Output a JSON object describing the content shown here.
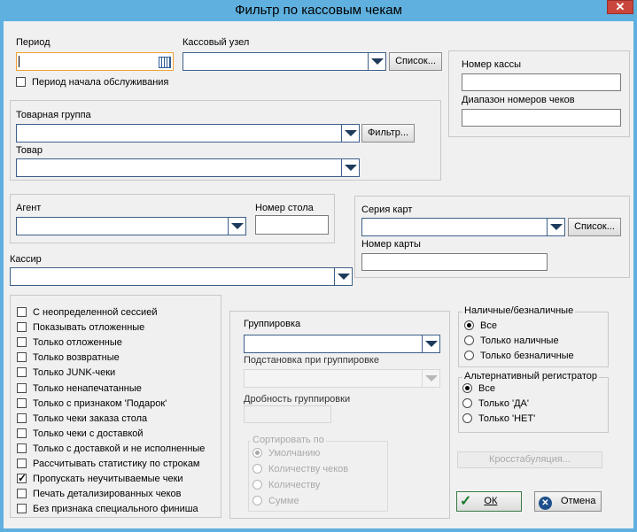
{
  "window": {
    "title": "Фильтр по кассовым чекам",
    "close_glyph": "✕"
  },
  "period": {
    "label": "Период",
    "value": "",
    "service_start_label": "Период начала обслуживания"
  },
  "cash_node": {
    "label": "Кассовый узел",
    "value": "",
    "list_button": "Список..."
  },
  "cash_desk": {
    "number_label": "Номер кассы",
    "number_value": "",
    "check_range_label": "Диапазон номеров чеков",
    "check_range_value": ""
  },
  "product": {
    "group_label": "Товарная группа",
    "group_value": "",
    "filter_button": "Фильтр...",
    "item_label": "Товар",
    "item_value": ""
  },
  "agent": {
    "label": "Агент",
    "value": "",
    "table_label": "Номер стола",
    "table_value": ""
  },
  "cards": {
    "series_label": "Серия карт",
    "series_value": "",
    "list_button": "Список...",
    "number_label": "Номер карты",
    "number_value": ""
  },
  "cashier": {
    "label": "Кассир",
    "value": ""
  },
  "options": [
    {
      "label": "С неопределенной сессией",
      "checked": false
    },
    {
      "label": "Показывать отложенные",
      "checked": false
    },
    {
      "label": "Только отложенные",
      "checked": false
    },
    {
      "label": "Только возвратные",
      "checked": false
    },
    {
      "label": "Только JUNK-чеки",
      "checked": false
    },
    {
      "label": "Только ненапечатанные",
      "checked": false
    },
    {
      "label": "Только с признаком 'Подарок'",
      "checked": false
    },
    {
      "label": "Только чеки заказа стола",
      "checked": false
    },
    {
      "label": "Только чеки с доставкой",
      "checked": false
    },
    {
      "label": "Только с доставкой и не исполненные",
      "checked": false
    },
    {
      "label": "Рассчитывать статистику по строкам",
      "checked": false
    },
    {
      "label": "Пропускать неучитываемые чеки",
      "checked": true
    },
    {
      "label": "Печать детализированных чеков",
      "checked": false
    },
    {
      "label": "Без признака специального финиша",
      "checked": false
    }
  ],
  "grouping": {
    "label": "Группировка",
    "value": "",
    "substitution_label": "Подстановка при группировке",
    "substitution_value": "",
    "fraction_label": "Дробность группировки",
    "fraction_value": "",
    "sort_legend": "Сортировать по",
    "sort_options": [
      "Умолчанию",
      "Количеству чеков",
      "Количеству",
      "Сумме"
    ],
    "sort_selected": 0
  },
  "payment": {
    "legend": "Наличные/безналичные",
    "options": [
      "Все",
      "Только наличные",
      "Только безналичные"
    ],
    "selected": 0
  },
  "alt_register": {
    "legend": "Альтернативный регистратор",
    "options": [
      "Все",
      "Только 'ДА'",
      "Только 'НЕТ'"
    ],
    "selected": 0
  },
  "buttons": {
    "crosstab": "Кросстабуляция...",
    "ok": "ОК",
    "cancel": "Отмена"
  },
  "colors": {
    "title_bar": "#5fb0de",
    "close_button": "#c9463d",
    "dialog_bg": "#f0f0f0",
    "active_focus": "#f0a030"
  }
}
